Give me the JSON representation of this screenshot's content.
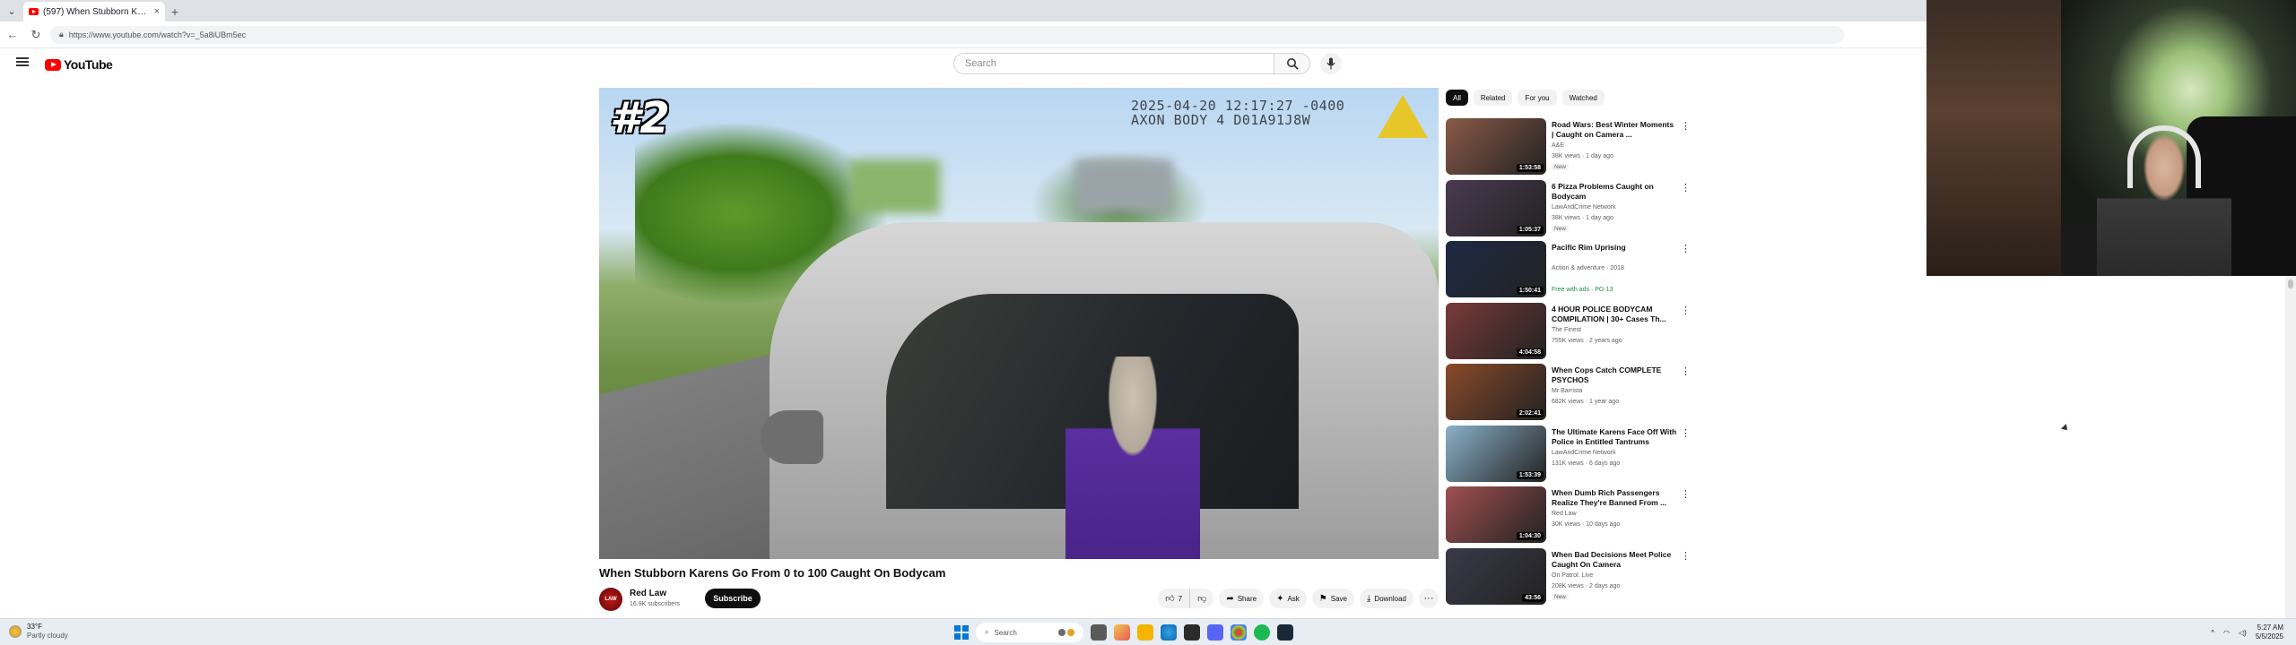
{
  "browser": {
    "tab_title": "(597) When Stubborn Karens",
    "tab_close": "×",
    "new_tab": "+",
    "url": "https://www.youtube.com/watch?v=_5a8iUBm5ec"
  },
  "youtube": {
    "logo_text": "YouTube",
    "search_placeholder": "Search"
  },
  "video": {
    "overlay_number": "#2",
    "timestamp_line1": "2025-04-20 12:17:27 -0400",
    "timestamp_line2": "AXON BODY 4 D01A91J8W",
    "title": "When Stubborn Karens Go From 0 to 100 Caught On Bodycam",
    "channel_name": "Red Law",
    "channel_avatar_text": "LAW",
    "subscribers": "16.9K subscribers",
    "subscribe_label": "Subscribe",
    "like_count": "7",
    "share_label": "Share",
    "ask_label": "Ask",
    "save_label": "Save",
    "download_label": "Download",
    "more_label": "···"
  },
  "chips": [
    "All",
    "Related",
    "For you",
    "Watched"
  ],
  "recommendations": [
    {
      "title": "Road Wars: Best Winter Moments | Caught on Camera ...",
      "channel": "A&E",
      "meta": "38K views · 1 day ago",
      "badge": "New",
      "duration": "1:53:58",
      "thumb_color": "#8a5a48"
    },
    {
      "title": "6 Pizza Problems Caught on Bodycam",
      "channel": "LawAndCrime Network",
      "meta": "38K views · 1 day ago",
      "badge": "New",
      "duration": "1:05:37",
      "thumb_color": "#4a3a52"
    },
    {
      "title": "Pacific Rim Uprising",
      "channel": "Action & adventure · 2018",
      "meta": "",
      "badge": "Free with ads · PG-13",
      "duration": "1:50:41",
      "thumb_color": "#1d2a44"
    },
    {
      "title": "4 HOUR POLICE BODYCAM COMPILATION | 30+ Cases Th...",
      "channel": "The Finest",
      "meta": "755K views · 2 years ago",
      "badge": "",
      "duration": "4:04:58",
      "thumb_color": "#7a3a3a"
    },
    {
      "title": "When Cops Catch COMPLETE PSYCHOS",
      "channel": "Mr Barrista",
      "meta": "682K views · 1 year ago",
      "badge": "",
      "duration": "2:02:41",
      "thumb_color": "#8a4a2a"
    },
    {
      "title": "The Ultimate Karens Face Off With Police in Entitled Tantrums",
      "channel": "LawAndCrime Network",
      "meta": "131K views · 6 days ago",
      "badge": "",
      "duration": "1:53:39",
      "thumb_color": "#8ab0c8"
    },
    {
      "title": "When Dumb Rich Passengers Realize They're Banned From ...",
      "channel": "Red Law",
      "meta": "30K views · 10 days ago",
      "badge": "",
      "duration": "1:04:30",
      "thumb_color": "#a05050"
    },
    {
      "title": "When Bad Decisions Meet Police Caught On Camera",
      "channel": "On Patrol: Live",
      "meta": "208K views · 2 days ago",
      "badge": "New",
      "duration": "43:56",
      "thumb_color": "#3a3a4a"
    }
  ],
  "taskbar": {
    "temperature": "33°F",
    "weather_desc": "Partly cloudy",
    "search_label": "Search",
    "time": "5:27 AM",
    "date": "5/5/2025"
  }
}
